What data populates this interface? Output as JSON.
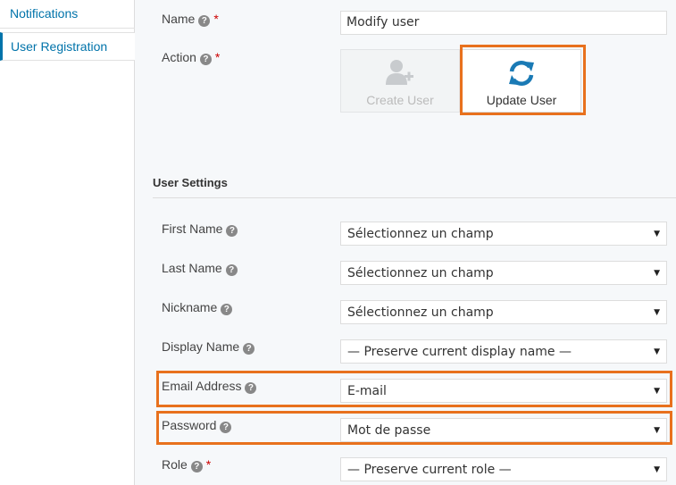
{
  "sidebar": {
    "items": [
      {
        "label": "Notifications"
      },
      {
        "label": "User Registration"
      }
    ]
  },
  "form": {
    "name": {
      "label": "Name",
      "value": "Modify user"
    },
    "action": {
      "label": "Action",
      "options": [
        {
          "label": "Create User",
          "icon": "add-user-icon",
          "state": "disabled"
        },
        {
          "label": "Update User",
          "icon": "refresh-icon",
          "state": "selected"
        }
      ]
    }
  },
  "user_settings": {
    "title": "User Settings",
    "fields": [
      {
        "label": "First Name",
        "value": "Sélectionnez un champ",
        "required": false
      },
      {
        "label": "Last Name",
        "value": "Sélectionnez un champ",
        "required": false
      },
      {
        "label": "Nickname",
        "value": "Sélectionnez un champ",
        "required": false
      },
      {
        "label": "Display Name",
        "value": "— Preserve current display name —",
        "required": false
      },
      {
        "label": "Email Address",
        "value": "E-mail",
        "required": false
      },
      {
        "label": "Password",
        "value": "Mot de passe",
        "required": false
      },
      {
        "label": "Role",
        "value": "— Preserve current role —",
        "required": true
      }
    ]
  },
  "symbols": {
    "required_mark": "*",
    "help_mark": "?",
    "caret": "▼"
  },
  "colors": {
    "accent": "#0073aa",
    "highlight": "#e8711d",
    "update_icon": "#1a7ab5",
    "create_icon": "#c8cbce"
  }
}
